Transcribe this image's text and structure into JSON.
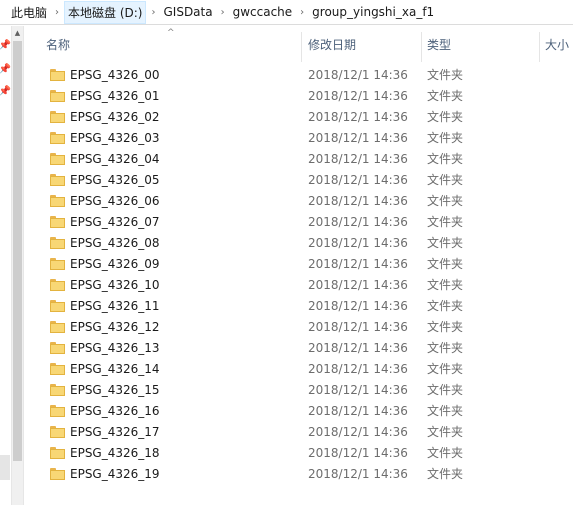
{
  "address": {
    "crumbs": [
      "此电脑",
      "本地磁盘 (D:)",
      "GISData",
      "gwccache",
      "group_yingshi_xa_f1"
    ],
    "separator": "›"
  },
  "columns": {
    "name": "名称",
    "modified": "修改日期",
    "type": "类型",
    "size": "大小"
  },
  "sort_indicator": "^",
  "rows": [
    {
      "name": "EPSG_4326_00",
      "modified": "2018/12/1 14:36",
      "type": "文件夹"
    },
    {
      "name": "EPSG_4326_01",
      "modified": "2018/12/1 14:36",
      "type": "文件夹"
    },
    {
      "name": "EPSG_4326_02",
      "modified": "2018/12/1 14:36",
      "type": "文件夹"
    },
    {
      "name": "EPSG_4326_03",
      "modified": "2018/12/1 14:36",
      "type": "文件夹"
    },
    {
      "name": "EPSG_4326_04",
      "modified": "2018/12/1 14:36",
      "type": "文件夹"
    },
    {
      "name": "EPSG_4326_05",
      "modified": "2018/12/1 14:36",
      "type": "文件夹"
    },
    {
      "name": "EPSG_4326_06",
      "modified": "2018/12/1 14:36",
      "type": "文件夹"
    },
    {
      "name": "EPSG_4326_07",
      "modified": "2018/12/1 14:36",
      "type": "文件夹"
    },
    {
      "name": "EPSG_4326_08",
      "modified": "2018/12/1 14:36",
      "type": "文件夹"
    },
    {
      "name": "EPSG_4326_09",
      "modified": "2018/12/1 14:36",
      "type": "文件夹"
    },
    {
      "name": "EPSG_4326_10",
      "modified": "2018/12/1 14:36",
      "type": "文件夹"
    },
    {
      "name": "EPSG_4326_11",
      "modified": "2018/12/1 14:36",
      "type": "文件夹"
    },
    {
      "name": "EPSG_4326_12",
      "modified": "2018/12/1 14:36",
      "type": "文件夹"
    },
    {
      "name": "EPSG_4326_13",
      "modified": "2018/12/1 14:36",
      "type": "文件夹"
    },
    {
      "name": "EPSG_4326_14",
      "modified": "2018/12/1 14:36",
      "type": "文件夹"
    },
    {
      "name": "EPSG_4326_15",
      "modified": "2018/12/1 14:36",
      "type": "文件夹"
    },
    {
      "name": "EPSG_4326_16",
      "modified": "2018/12/1 14:36",
      "type": "文件夹"
    },
    {
      "name": "EPSG_4326_17",
      "modified": "2018/12/1 14:36",
      "type": "文件夹"
    },
    {
      "name": "EPSG_4326_18",
      "modified": "2018/12/1 14:36",
      "type": "文件夹"
    },
    {
      "name": "EPSG_4326_19",
      "modified": "2018/12/1 14:36",
      "type": "文件夹"
    }
  ],
  "icons": {
    "folder": "folder-icon",
    "pin": "pin-icon",
    "chevron": "chevron-right-icon"
  },
  "colors": {
    "folder_fill": "#f8d775",
    "header_text": "#4c607a",
    "secondary_text": "#6d6d6d",
    "hover_crumb": "#e5f3ff"
  }
}
